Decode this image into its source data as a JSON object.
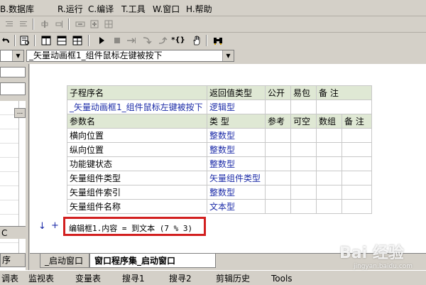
{
  "menu": [
    {
      "label": "B.数据库"
    },
    {
      "label": "R.运行"
    },
    {
      "label": "C.编译"
    },
    {
      "label": "T.工具"
    },
    {
      "label": "W.窗口"
    },
    {
      "label": "H.帮助"
    }
  ],
  "menu_partial_first": "数据库",
  "toolbar1": {
    "icons": [
      "indent-left-icon",
      "indent-right-icon",
      "align-center-icon",
      "align-right-icon",
      "stretch-h-icon",
      "grid-add-icon",
      "grid-grid-icon"
    ]
  },
  "toolbar2": {
    "glyphs": {
      "undo": "↩",
      "preview": "▣",
      "view1": "▥",
      "view2": "▤",
      "view3": "▦",
      "run": "▶",
      "stop": "■",
      "step1": "⇥",
      "step2": "⤵",
      "step3": "⤴",
      "braces": "*{}",
      "hand": "✋",
      "binoc": "👓"
    }
  },
  "combo": {
    "left_value": "",
    "right_value": "_矢量动画框1_组件鼠标左键被按下"
  },
  "leftpanel": {
    "ellipsis": "...",
    "label_c": "C",
    "label_xu": "序"
  },
  "table": {
    "header1": [
      "子程序名",
      "返回值类型",
      "公开",
      "易包",
      "备 注"
    ],
    "row1": [
      "_矢量动画框1_组件鼠标左键被按下",
      "逻辑型",
      "",
      "",
      ""
    ],
    "header2": [
      "参数名",
      "类 型",
      "参考",
      "可空",
      "数组",
      "备 注"
    ],
    "params": [
      {
        "name": "横向位置",
        "type": "整数型"
      },
      {
        "name": "纵向位置",
        "type": "整数型"
      },
      {
        "name": "功能键状态",
        "type": "整数型"
      },
      {
        "name": "矢量组件类型",
        "type": "矢量组件类型"
      },
      {
        "name": "矢量组件索引",
        "type": "整数型"
      },
      {
        "name": "矢量组件名称",
        "type": "文本型"
      }
    ]
  },
  "code": {
    "arrow": "↓",
    "plus": "+",
    "line": "编辑框1.内容 = 到文本 (7 % 3)"
  },
  "tabs": [
    {
      "label": "_启动窗口",
      "active": false
    },
    {
      "label": "窗口程序集_启动窗口",
      "active": true
    }
  ],
  "bottom": [
    {
      "label": "监视表"
    },
    {
      "label": "变量表"
    },
    {
      "label": "搜寻1"
    },
    {
      "label": "搜寻2"
    },
    {
      "label": "剪辑历史"
    },
    {
      "label": "Tools"
    }
  ],
  "bottom_partial_first": "调表",
  "watermark": {
    "text": "Bai 经验",
    "sub": "jingyan.baidu.com"
  }
}
